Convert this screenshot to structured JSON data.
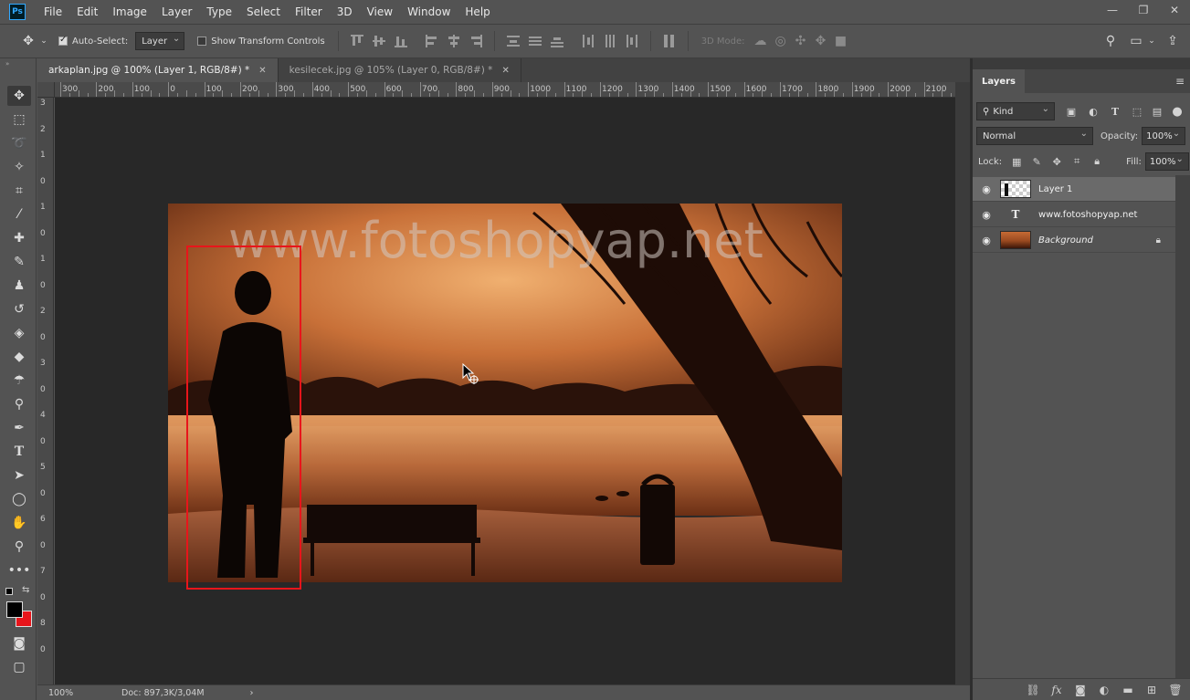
{
  "app": {
    "logo": "Ps"
  },
  "menu": [
    "File",
    "Edit",
    "Image",
    "Layer",
    "Type",
    "Select",
    "Filter",
    "3D",
    "View",
    "Window",
    "Help"
  ],
  "options": {
    "auto_select_label": "Auto-Select:",
    "auto_select_value": "Layer",
    "transform_label": "Show Transform Controls",
    "mode_3d_label": "3D Mode:"
  },
  "tabs": [
    {
      "label": "arkaplan.jpg @ 100% (Layer 1, RGB/8#) *",
      "active": true
    },
    {
      "label": "kesilecek.jpg @ 105% (Layer 0, RGB/8#) *",
      "active": false
    }
  ],
  "ruler": {
    "h_labels": [
      "300",
      "200",
      "100",
      "0",
      "100",
      "200",
      "300",
      "400",
      "500",
      "600",
      "700",
      "800",
      "900",
      "1000",
      "1100",
      "1200",
      "1300",
      "1400",
      "1500",
      "1600",
      "1700",
      "1800",
      "1900",
      "2000",
      "2100"
    ],
    "v_labels": [
      "3",
      "2",
      "1",
      "0",
      "1",
      "0",
      "1",
      "0",
      "2",
      "0",
      "3",
      "0",
      "4",
      "0",
      "5",
      "0",
      "6",
      "0",
      "7",
      "0",
      "8",
      "0"
    ]
  },
  "canvas": {
    "watermark": "www.fotoshopyap.net"
  },
  "status": {
    "zoom": "100%",
    "doc": "Doc: 897,3K/3,04M"
  },
  "layers_panel": {
    "title": "Layers",
    "filter_kind": "Kind",
    "blend_mode": "Normal",
    "opacity_label": "Opacity:",
    "opacity_value": "100%",
    "lock_label": "Lock:",
    "fill_label": "Fill:",
    "fill_value": "100%",
    "layers": [
      {
        "name": "Layer 1",
        "type": "image",
        "selected": true,
        "italic": false
      },
      {
        "name": "www.fotoshopyap.net",
        "type": "text",
        "selected": false,
        "italic": false
      },
      {
        "name": "Background",
        "type": "image",
        "selected": false,
        "italic": true,
        "locked": true
      }
    ]
  },
  "colors": {
    "accent_blue": "#31a8ff",
    "selection_red": "#e8151b",
    "foreground_color": "#000000",
    "background_color": "#e8151b"
  }
}
